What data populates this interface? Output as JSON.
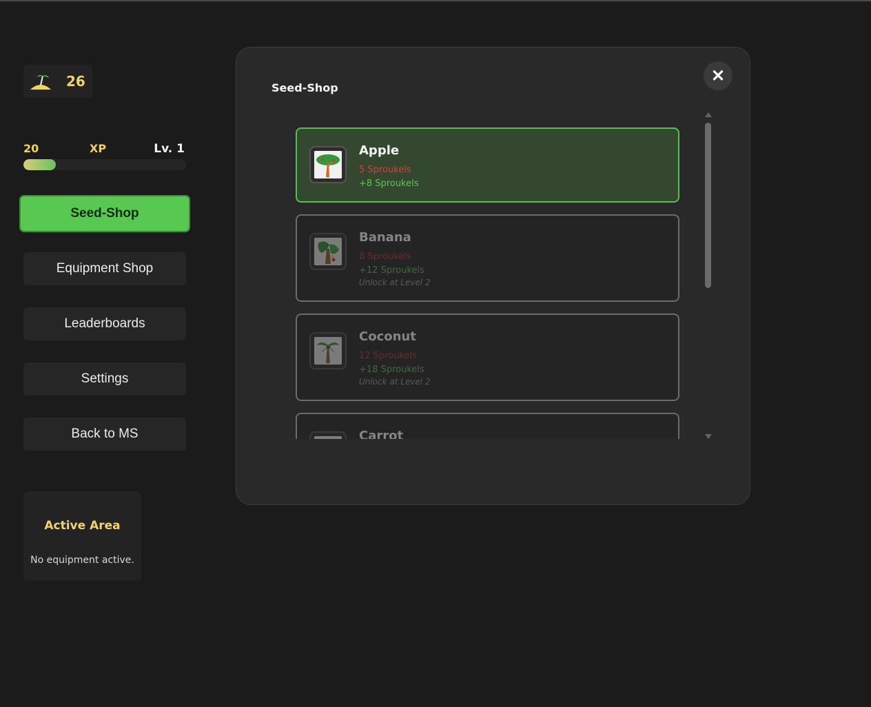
{
  "currency": {
    "icon": "island-palm-icon",
    "amount": "26"
  },
  "xp": {
    "current": "20",
    "label": "XP",
    "level": "Lv. 1",
    "progress": 0.2
  },
  "nav": {
    "seed_shop": "Seed-Shop",
    "equipment_shop": "Equipment Shop",
    "leaderboards": "Leaderboards",
    "settings": "Settings",
    "back": "Back to MS"
  },
  "active_area": {
    "title": "Active Area",
    "message": "No equipment active."
  },
  "modal": {
    "title": "Seed-Shop",
    "close": "✕",
    "seeds": [
      {
        "name": "Apple",
        "cost": "5 Sproukels",
        "reward": "+8 Sproukels",
        "lock": "",
        "icon": "apple-tree-icon",
        "locked": false
      },
      {
        "name": "Banana",
        "cost": "8 Sproukels",
        "reward": "+12 Sproukels",
        "lock": "Unlock at Level 2",
        "icon": "banana-tree-icon",
        "locked": true
      },
      {
        "name": "Coconut",
        "cost": "12 Sproukels",
        "reward": "+18 Sproukels",
        "lock": "Unlock at Level 2",
        "icon": "coconut-palm-icon",
        "locked": true
      },
      {
        "name": "Carrot",
        "cost": "",
        "reward": "",
        "lock": "",
        "icon": "carrot-icon",
        "locked": true
      }
    ]
  },
  "colors": {
    "accent": "#57c950",
    "gold": "#f2d36b",
    "cost": "#e23a36",
    "reward": "#5bc84f"
  }
}
